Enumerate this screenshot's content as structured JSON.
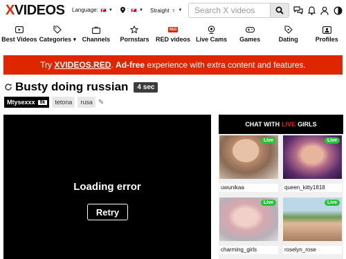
{
  "header": {
    "logo_x": "X",
    "logo_rest": "VIDEOS",
    "language_label": "Language:",
    "straight_label": "Straight",
    "search_placeholder": "Search X videos"
  },
  "nav": [
    {
      "label": "Best Videos",
      "icon": "video-icon"
    },
    {
      "label": "Categories ▾",
      "icon": "tags-icon"
    },
    {
      "label": "Channels",
      "icon": "tv-icon"
    },
    {
      "label": "Pornstars",
      "icon": "star-icon"
    },
    {
      "label": "RED videos",
      "icon": "red-badge-icon",
      "badge": "RED"
    },
    {
      "label": "Live Cams",
      "icon": "webcam-icon"
    },
    {
      "label": "Games",
      "icon": "gamepad-icon"
    },
    {
      "label": "Dating",
      "icon": "heart-tag-icon"
    },
    {
      "label": "Profiles",
      "icon": "profiles-icon"
    }
  ],
  "promo": {
    "pre": "Try ",
    "link": "XVIDEOS.RED",
    "mid": ". ",
    "bold": "Ad-free",
    "post": " experience with extra content and features."
  },
  "video": {
    "title": "Busty doing russian",
    "duration": "4 sec",
    "uploader": "Mtysexxx",
    "uploader_subs": "8k",
    "tags": [
      "tetona",
      "rusa"
    ],
    "error": "Loading error",
    "retry": "Retry"
  },
  "chat": {
    "pre": "CHAT WITH",
    "live": "LIVE",
    "post": "GIRLS",
    "live_badge": "Live",
    "cams": [
      {
        "name": "uwunikaa"
      },
      {
        "name": "queen_kitty1818"
      },
      {
        "name": "charming_girls"
      },
      {
        "name": "roselyn_rose"
      }
    ]
  },
  "colors": {
    "brand_red": "#de2600",
    "live_green": "#2bc03a"
  }
}
